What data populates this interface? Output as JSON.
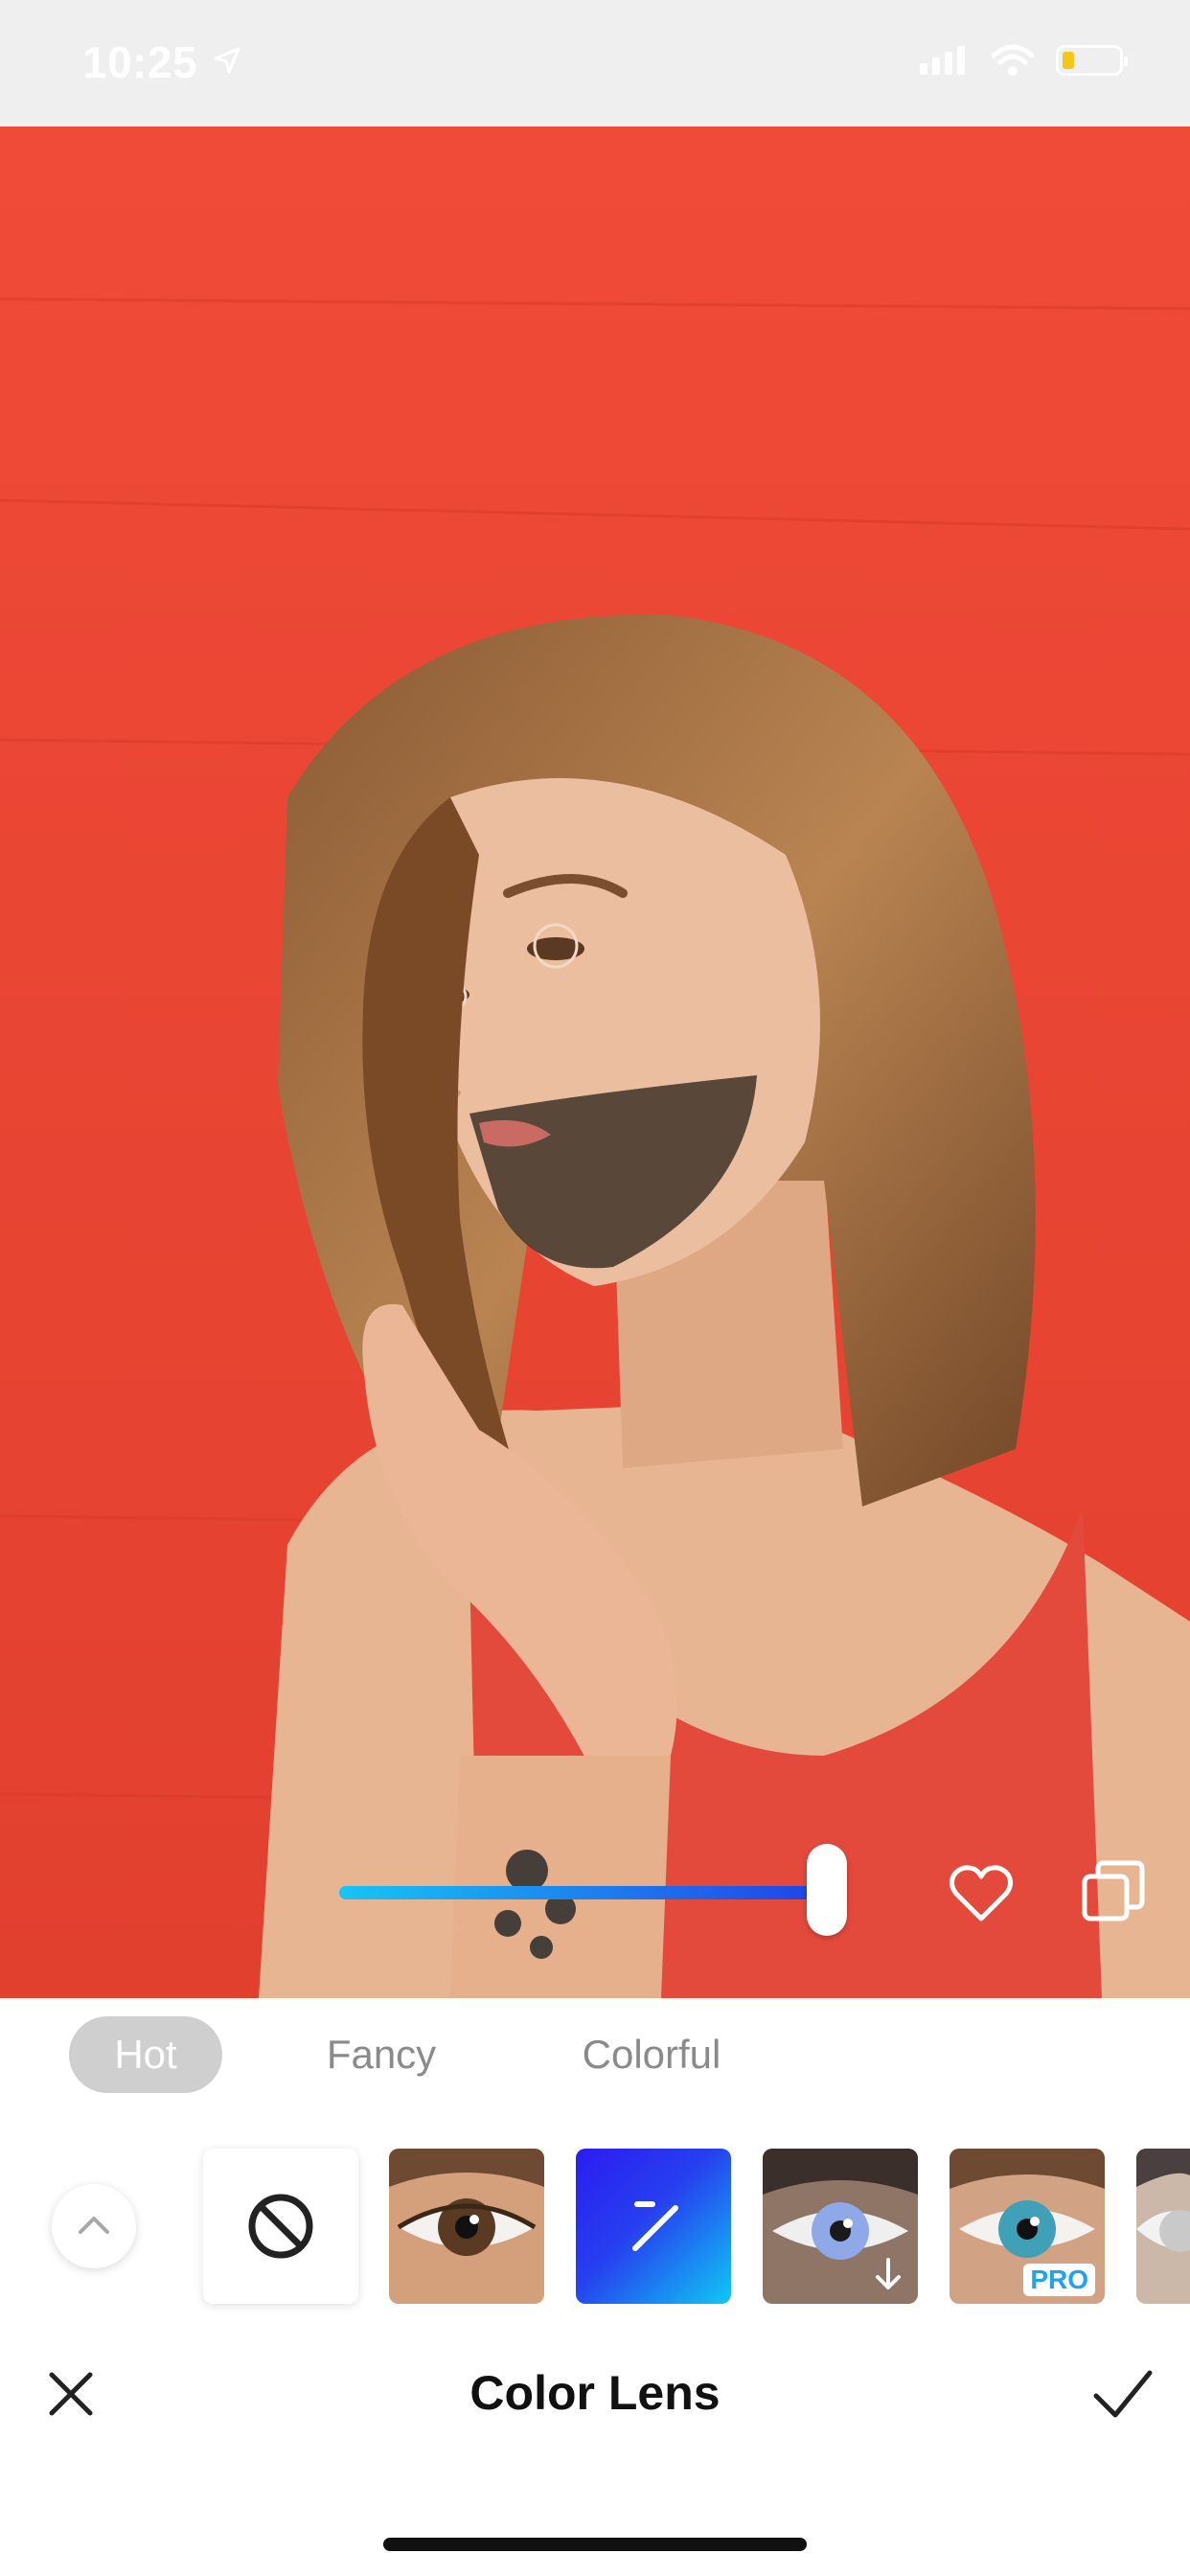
{
  "status_bar": {
    "time": "10:25",
    "icons": [
      "location-arrow-icon",
      "cellular-signal-icon",
      "wifi-icon",
      "battery-icon"
    ],
    "battery_fill_fraction": 0.12,
    "battery_color": "#f5c518"
  },
  "photo": {
    "background_color": "#ec4535"
  },
  "controls": {
    "intensity": 1.0,
    "slider_colors": [
      "#18c4f6",
      "#2241e6"
    ],
    "favorite_icon": "heart-outline-icon",
    "compare_icon": "compare-layers-icon"
  },
  "tabs": [
    {
      "label": "Hot",
      "selected": true
    },
    {
      "label": "Fancy",
      "selected": false
    },
    {
      "label": "Colorful",
      "selected": false
    }
  ],
  "lenses": [
    {
      "name": "none",
      "icon": "no-symbol-icon"
    },
    {
      "name": "brown",
      "iris_color": "#5a3a22"
    },
    {
      "name": "custom",
      "icon": "edit-plus-minus-icon"
    },
    {
      "name": "blue",
      "iris_color": "#8fa8e8",
      "badge_icon": "download-arrow-icon"
    },
    {
      "name": "teal",
      "iris_color": "#3fa0b8",
      "badge": "PRO"
    },
    {
      "name": "gray",
      "iris_color": "#c9c9c9"
    }
  ],
  "bottom_bar": {
    "title": "Color Lens",
    "close_icon": "close-icon",
    "confirm_icon": "checkmark-icon"
  }
}
